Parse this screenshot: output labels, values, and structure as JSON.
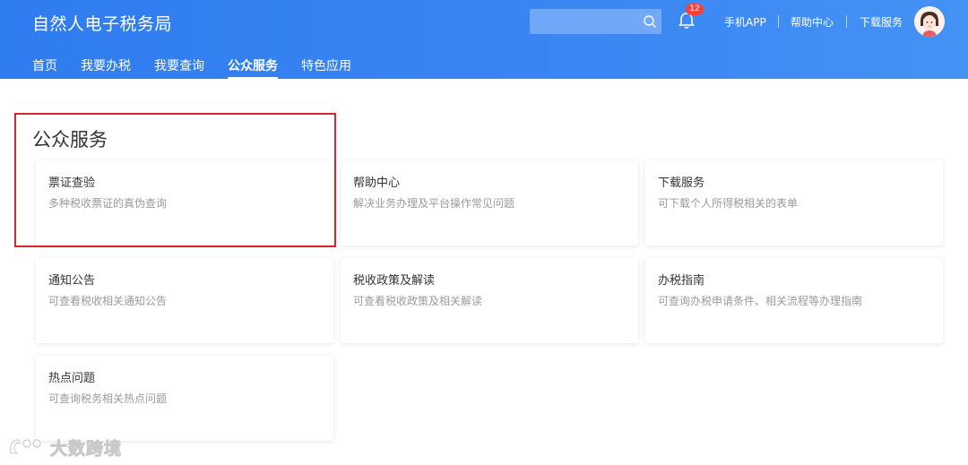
{
  "header": {
    "app_title": "自然人电子税务局",
    "search": {
      "placeholder": "",
      "value": ""
    },
    "notification_count": "12",
    "links": {
      "mobile_app": "手机APP",
      "help_center": "帮助中心",
      "download": "下载服务"
    }
  },
  "nav": {
    "items": [
      {
        "label": "首页"
      },
      {
        "label": "我要办税"
      },
      {
        "label": "我要查询"
      },
      {
        "label": "公众服务",
        "active": true
      },
      {
        "label": "特色应用"
      }
    ]
  },
  "main": {
    "section_title": "公众服务",
    "cards": [
      {
        "title": "票证查验",
        "desc": "多种税收票证的真伪查询"
      },
      {
        "title": "帮助中心",
        "desc": "解决业务办理及平台操作常见问题"
      },
      {
        "title": "下载服务",
        "desc": "可下载个人所得税相关的表单"
      },
      {
        "title": "通知公告",
        "desc": "可查看税收相关通知公告"
      },
      {
        "title": "税收政策及解读",
        "desc": "可查看税收政策及相关解读"
      },
      {
        "title": "办税指南",
        "desc": "可查询办税申请条件、相关流程等办理指南"
      },
      {
        "title": "热点问题",
        "desc": "可查询税务相关热点问题"
      }
    ]
  },
  "watermark": {
    "text": "大数跨境"
  },
  "colors": {
    "header_blue": "#3a86f3",
    "highlight_red": "#d9262b",
    "badge_red": "#f5433a"
  }
}
